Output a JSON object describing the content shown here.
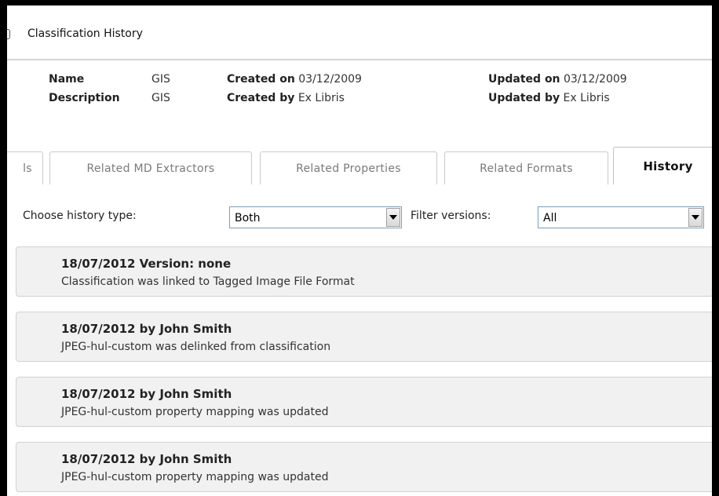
{
  "window": {
    "title": "Classification History"
  },
  "meta": {
    "name_label": "Name",
    "name_value": "GIS",
    "description_label": "Description",
    "description_value": "GIS",
    "created_on_label": "Created on",
    "created_on_value": "03/12/2009",
    "created_by_label": "Created by",
    "created_by_value": "Ex Libris",
    "updated_on_label": "Updated on",
    "updated_on_value": "03/12/2009",
    "updated_by_label": "Updated by",
    "updated_by_value": "Ex Libris"
  },
  "tabs": [
    {
      "label": "ls",
      "active": false
    },
    {
      "label": "Related MD Extractors",
      "active": false
    },
    {
      "label": "Related Properties",
      "active": false
    },
    {
      "label": "Related Formats",
      "active": false
    },
    {
      "label": "History",
      "active": true
    }
  ],
  "filters": {
    "history_type_label": "Choose history type:",
    "history_type_value": "Both",
    "versions_label": "Filter versions:",
    "versions_value": "All"
  },
  "history": [
    {
      "header": "18/07/2012 Version: none",
      "text": "Classification was linked to Tagged Image File Format"
    },
    {
      "header": "18/07/2012 by John Smith",
      "text": "JPEG-hul-custom was delinked from classification"
    },
    {
      "header": "18/07/2012 by John Smith",
      "text": "JPEG-hul-custom property mapping was updated"
    },
    {
      "header": "18/07/2012 by John Smith",
      "text": "JPEG-hul-custom property mapping was updated"
    }
  ]
}
